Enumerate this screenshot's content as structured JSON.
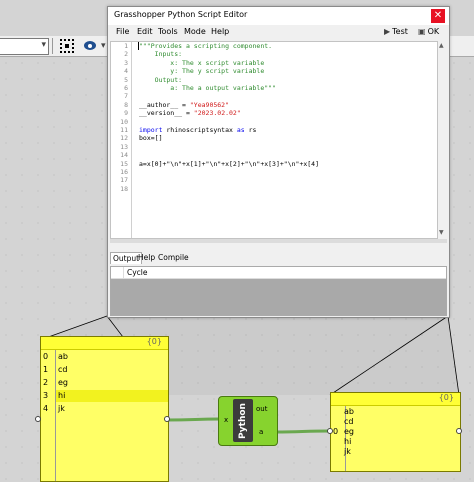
{
  "editor": {
    "title": "Grasshopper Python Script Editor",
    "close_glyph": "✕",
    "menu": [
      "File",
      "Edit",
      "Tools",
      "Mode",
      "Help"
    ],
    "test_label": "Test",
    "ok_label": "OK",
    "line_numbers": [
      "1",
      "2",
      "3",
      "4",
      "5",
      "6",
      "7",
      "8",
      "9",
      "10",
      "11",
      "12",
      "13",
      "14",
      "15",
      "16",
      "17",
      "18"
    ],
    "code": {
      "l1": "\"\"\"Provides a scripting component.",
      "l2": "    Inputs:",
      "l3": "        x: The x script variable",
      "l4": "        y: The y script variable",
      "l5": "    Output:",
      "l6": "        a: The a output variable\"\"\"",
      "l8_a": "__author__ = ",
      "l8_b": "\"Yea90562\"",
      "l9_a": "__version__ = ",
      "l9_b": "\"2023.02.02\"",
      "l11_kw1": "import",
      "l11_mid": " rhinoscriptsyntax ",
      "l11_kw2": "as",
      "l11_end": " rs",
      "l12": "box=[]",
      "l15": "a=x[0]+\"\\n\"+x[1]+\"\\n\"+x[2]+\"\\n\"+x[3]+\"\\n\"+x[4]"
    },
    "output_tabs": [
      "Output",
      "Help",
      "Compile"
    ],
    "output_column": "Cycle"
  },
  "panel_left": {
    "header": "{0}",
    "indices": [
      "0",
      "1",
      "2",
      "3",
      "4"
    ],
    "items": [
      "ab",
      "cd",
      "eg",
      "hi",
      "jk"
    ]
  },
  "panel_right": {
    "header": "{0}",
    "index": "0",
    "items": [
      "ab",
      "cd",
      "eg",
      "hi",
      "jk"
    ]
  },
  "python_component": {
    "label": "Python",
    "input": "x",
    "outputs": [
      "out",
      "a"
    ]
  },
  "colors": {
    "panel": "#ffff66",
    "component": "#87d32e",
    "wire": "#5a9a2e"
  }
}
